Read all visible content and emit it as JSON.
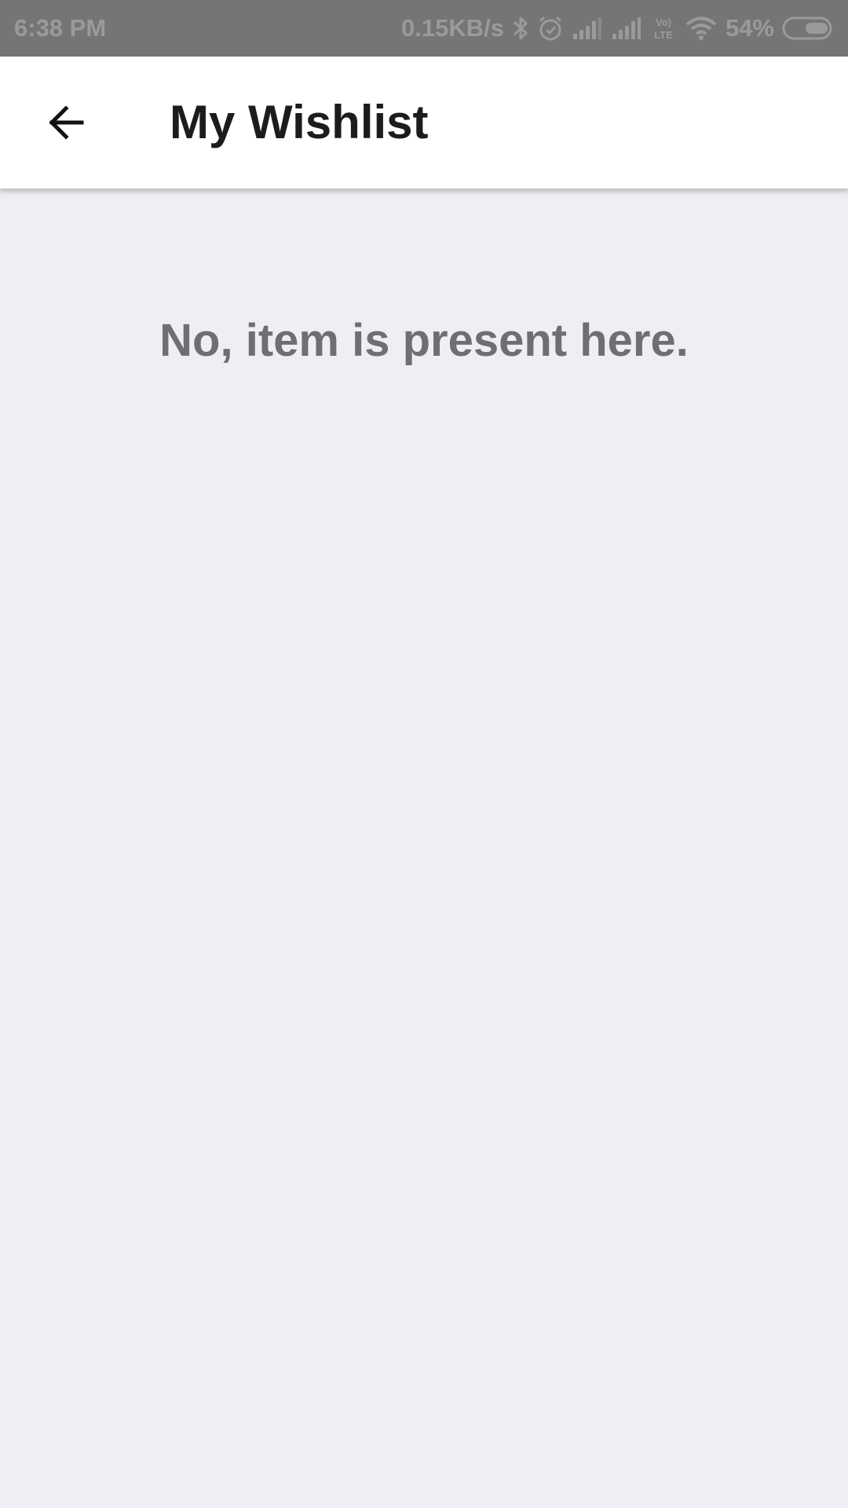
{
  "status_bar": {
    "time": "6:38 PM",
    "network_speed": "0.15KB/s",
    "battery_percent": "54%",
    "icons": [
      "bluetooth-icon",
      "alarm-icon",
      "signal-icon",
      "signal-icon",
      "volte-icon",
      "wifi-icon",
      "battery-icon"
    ],
    "volte_label_top": "Vo)",
    "volte_label_bottom": "LTE",
    "battery_level": 0.54
  },
  "app_bar": {
    "back_icon": "arrow-left-icon",
    "title": "My Wishlist"
  },
  "main": {
    "empty_message": "No, item is present here."
  },
  "colors": {
    "status_bar_bg": "#757575",
    "app_bar_bg": "#ffffff",
    "page_bg": "#efeef4",
    "title_text": "#1c1c1c",
    "empty_text": "#6f6f73"
  }
}
